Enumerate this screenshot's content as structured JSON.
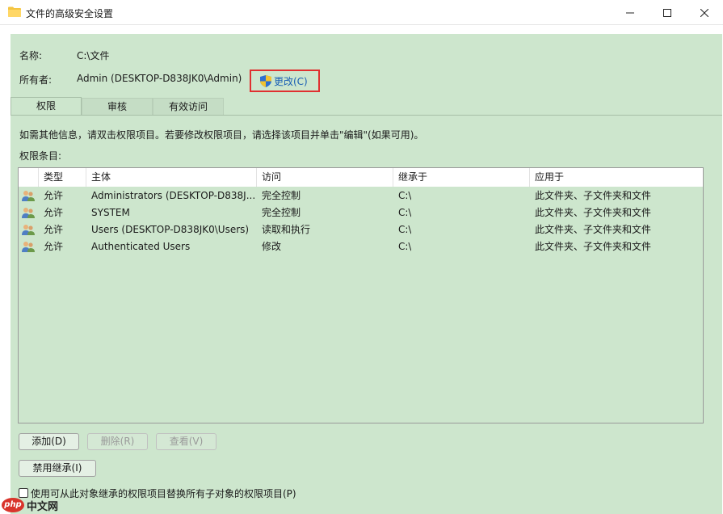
{
  "window": {
    "title": "文件的高级安全设置"
  },
  "header": {
    "name_label": "名称:",
    "name_value": "C:\\文件",
    "owner_label": "所有者:",
    "owner_value": "Admin (DESKTOP-D838JK0\\Admin)",
    "change_owner_label": "更改(C)"
  },
  "tabs": [
    {
      "label": "权限",
      "active": true
    },
    {
      "label": "审核",
      "active": false
    },
    {
      "label": "有效访问",
      "active": false
    }
  ],
  "info_text": "如需其他信息，请双击权限项目。若要修改权限项目，请选择该项目并单击\"编辑\"(如果可用)。",
  "entries_label": "权限条目:",
  "table": {
    "columns": [
      "类型",
      "主体",
      "访问",
      "继承于",
      "应用于"
    ],
    "rows": [
      {
        "type": "允许",
        "principal": "Administrators (DESKTOP-D838J...",
        "access": "完全控制",
        "inherited_from": "C:\\",
        "applies_to": "此文件夹、子文件夹和文件"
      },
      {
        "type": "允许",
        "principal": "SYSTEM",
        "access": "完全控制",
        "inherited_from": "C:\\",
        "applies_to": "此文件夹、子文件夹和文件"
      },
      {
        "type": "允许",
        "principal": "Users (DESKTOP-D838JK0\\Users)",
        "access": "读取和执行",
        "inherited_from": "C:\\",
        "applies_to": "此文件夹、子文件夹和文件"
      },
      {
        "type": "允许",
        "principal": "Authenticated Users",
        "access": "修改",
        "inherited_from": "C:\\",
        "applies_to": "此文件夹、子文件夹和文件"
      }
    ]
  },
  "buttons": {
    "add": "添加(D)",
    "remove": "删除(R)",
    "view": "查看(V)",
    "disable_inheritance": "禁用继承(I)"
  },
  "replace_checkbox": {
    "label": "使用可从此对象继承的权限项目替换所有子对象的权限项目(P)",
    "checked": false
  },
  "watermark": {
    "logo": "php",
    "text": "中文网"
  },
  "colors": {
    "content_bg": "#cde6cd",
    "highlight_border": "#e03030",
    "link": "#1a5fb4"
  }
}
